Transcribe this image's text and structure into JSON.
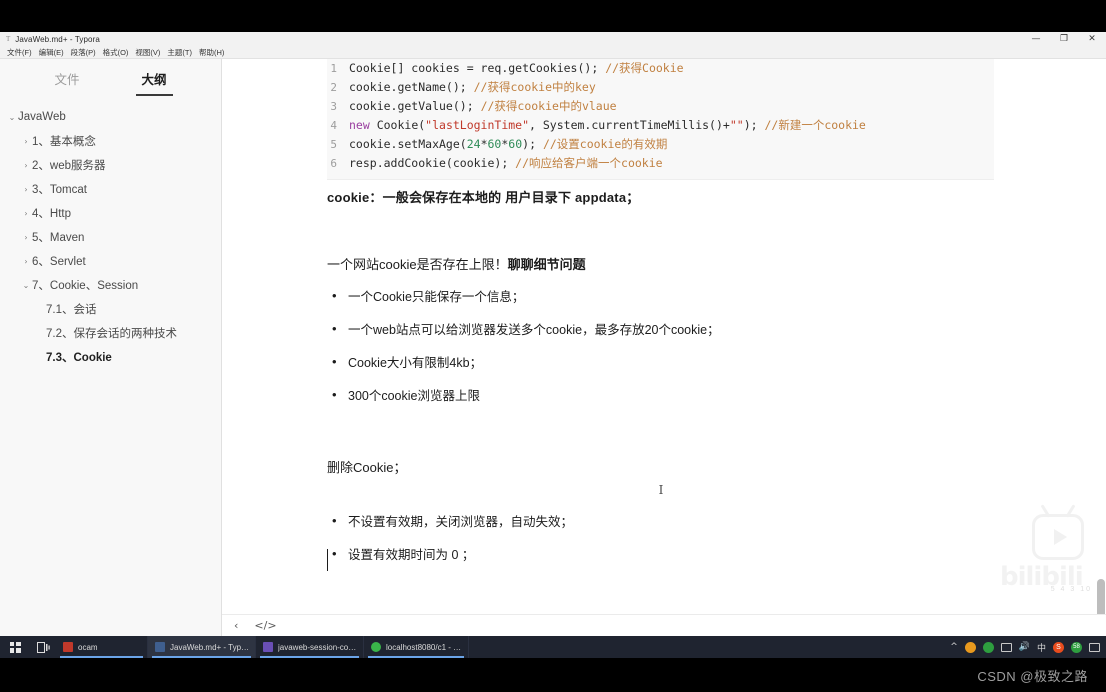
{
  "window": {
    "title": "JavaWeb.md+ - Typora",
    "title_icon": "T",
    "minimize": "—",
    "maximize": "❐",
    "close": "✕"
  },
  "menubar": {
    "items": [
      "文件(F)",
      "编辑(E)",
      "段落(P)",
      "格式(O)",
      "视图(V)",
      "主题(T)",
      "帮助(H)"
    ]
  },
  "sidebar": {
    "tabs": [
      {
        "label": "文件",
        "active": false
      },
      {
        "label": "大纲",
        "active": true
      }
    ],
    "outline": [
      {
        "label": "JavaWeb",
        "caret": "⌄",
        "level": 0,
        "bold": false
      },
      {
        "label": "1、基本概念",
        "caret": "›",
        "level": 1,
        "bold": false
      },
      {
        "label": "2、web服务器",
        "caret": "›",
        "level": 1,
        "bold": false
      },
      {
        "label": "3、Tomcat",
        "caret": "›",
        "level": 1,
        "bold": false
      },
      {
        "label": "4、Http",
        "caret": "›",
        "level": 1,
        "bold": false
      },
      {
        "label": "5、Maven",
        "caret": "›",
        "level": 1,
        "bold": false
      },
      {
        "label": "6、Servlet",
        "caret": "›",
        "level": 1,
        "bold": false
      },
      {
        "label": "7、Cookie、Session",
        "caret": "⌄",
        "level": 1,
        "bold": false
      },
      {
        "label": "7.1、会话",
        "caret": "",
        "level": 2,
        "bold": false
      },
      {
        "label": "7.2、保存会话的两种技术",
        "caret": "",
        "level": 2,
        "bold": false
      },
      {
        "label": "7.3、Cookie",
        "caret": "",
        "level": 2,
        "bold": true
      }
    ]
  },
  "editor": {
    "code_block": {
      "language": "java",
      "lines": [
        {
          "n": "1",
          "text": "Cookie[] cookies = req.getCookies(); //获得Cookie"
        },
        {
          "n": "2",
          "text": "cookie.getName(); //获得cookie中的key"
        },
        {
          "n": "3",
          "text": "cookie.getValue(); //获得cookie中的vlaue"
        },
        {
          "n": "4",
          "text": "new Cookie(\"lastLoginTime\", System.currentTimeMillis()+\"\"); //新建一个cookie"
        },
        {
          "n": "5",
          "text": "cookie.setMaxAge(24*60*60); //设置cookie的有效期"
        },
        {
          "n": "6",
          "text": "resp.addCookie(cookie); //响应给客户端一个cookie"
        }
      ]
    },
    "para_1": "cookie：一般会保存在本地的 用户目录下 appdata；",
    "para_2_normal": "一个网站cookie是否存在上限！",
    "para_2_bold": "聊聊细节问题",
    "list_1": [
      "一个Cookie只能保存一个信息；",
      "一个web站点可以给浏览器发送多个cookie，最多存放20个cookie；",
      "Cookie大小有限制4kb；",
      "300个cookie浏览器上限"
    ],
    "para_3": "删除Cookie；",
    "list_2": [
      "不设置有效期，关闭浏览器，自动失效；",
      "设置有效期时间为 0 ；"
    ],
    "mouse_caret": "I"
  },
  "statusbar": {
    "back_icon": "‹",
    "source_icon": "</>"
  },
  "watermark": {
    "brand": "bilibili",
    "counter": "5 4 3 10"
  },
  "taskbar": {
    "start_label": "start",
    "taskview_label": "task-view",
    "apps": [
      {
        "label": "ocam",
        "icon": "ocam-icon",
        "active": false
      },
      {
        "label": "JavaWeb.md+ - Typ…",
        "icon": "typora-icon",
        "active": true
      },
      {
        "label": "javaweb-session-co…",
        "icon": "idea-icon",
        "active": false
      },
      {
        "label": "localhost8080/c1 - …",
        "icon": "chrome-icon",
        "active": false
      }
    ],
    "tray": {
      "chevron": "^",
      "ime": "中",
      "sogou": "S",
      "badge": "58"
    }
  },
  "footer": {
    "text": "CSDN @极致之路"
  }
}
